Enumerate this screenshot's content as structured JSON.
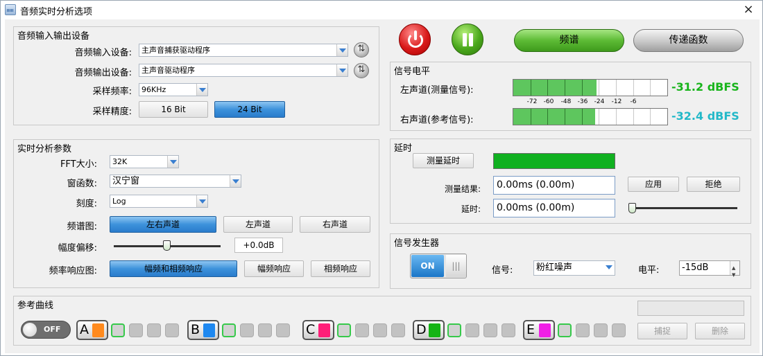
{
  "window": {
    "title": "音频实时分析选项",
    "close": "×"
  },
  "io": {
    "title": "音频输入输出设备",
    "input_label": "音频输入设备:",
    "input_value": "主声音捕获驱动程序",
    "output_label": "音频输出设备:",
    "output_value": "主声音驱动程序",
    "rate_label": "采样频率:",
    "rate_value": "96KHz",
    "depth_label": "采样精度:",
    "depth_16": "16 Bit",
    "depth_24": "24 Bit"
  },
  "analysis": {
    "title": "实时分析参数",
    "fft_label": "FFT大小:",
    "fft_value": "32K",
    "window_label": "窗函数:",
    "window_value": "汉宁窗",
    "scale_label": "刻度:",
    "scale_value": "Log",
    "spectrum_label": "频谱图:",
    "spectrum_both": "左右声道",
    "spectrum_left": "左声道",
    "spectrum_right": "右声道",
    "offset_label": "幅度偏移:",
    "offset_value": "+0.0dB",
    "offset_level": 0.5,
    "freqresp_label": "频率响应图:",
    "freqresp_both": "幅频和相频响应",
    "freqresp_amp": "幅频响应",
    "freqresp_phase": "相频响应"
  },
  "top_buttons": {
    "spectrum": "频谱",
    "transfer": "传递函数"
  },
  "level": {
    "title": "信号电平",
    "left_label": "左声道(测量信号):",
    "right_label": "右声道(参考信号):",
    "left_value": "-31.2 dBFS",
    "right_value": "-32.4 dBFS",
    "left_fill": 0.54,
    "right_fill": 0.53,
    "ticks": [
      "-72",
      "-60",
      "-48",
      "-36",
      "-24",
      "-12",
      "-6"
    ],
    "left_color": "#18b41b",
    "right_color": "#22b8c8"
  },
  "delay": {
    "title": "延时",
    "measure_button": "测量延时",
    "result_label": "测量结果:",
    "result_value": "0.00ms  (0.00m)",
    "delay_label": "延时:",
    "delay_value": "0.00ms  (0.00m)",
    "apply_button": "应用",
    "reject_button": "拒绝",
    "bar_color": "#10b020",
    "slider_level": 0
  },
  "generator": {
    "title": "信号发生器",
    "toggle_on": "ON",
    "toggle_grip": "|||",
    "signal_label": "信号:",
    "signal_value": "粉红噪声",
    "level_label": "电平:",
    "level_value": "-15dB"
  },
  "reference": {
    "title": "参考曲线",
    "toggle_off": "OFF",
    "groups": [
      {
        "letter": "A",
        "color": "#ff8a1e"
      },
      {
        "letter": "B",
        "color": "#1e88f0"
      },
      {
        "letter": "C",
        "color": "#ff1e78"
      },
      {
        "letter": "D",
        "color": "#14b414"
      },
      {
        "letter": "E",
        "color": "#f01ee6"
      }
    ],
    "capture_button": "捕捉",
    "delete_button": "删除"
  }
}
